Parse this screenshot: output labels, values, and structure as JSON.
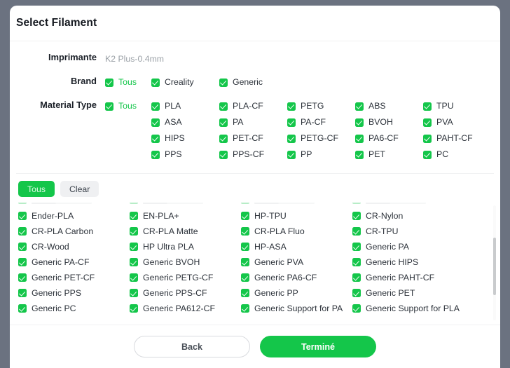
{
  "dialog": {
    "title": "Select Filament"
  },
  "filters": {
    "printer": {
      "label": "Imprimante",
      "value": "K2 Plus-0.4mm"
    },
    "brand": {
      "label": "Brand",
      "options": [
        {
          "label": "Tous",
          "checked": true,
          "accent": true
        },
        {
          "label": "Creality",
          "checked": true,
          "accent": false
        },
        {
          "label": "Generic",
          "checked": true,
          "accent": false
        }
      ]
    },
    "material_type": {
      "label": "Material Type",
      "all_label": "Tous",
      "all_checked": true,
      "rows": [
        [
          "PLA",
          "PLA-CF",
          "PETG",
          "ABS",
          "TPU"
        ],
        [
          "ASA",
          "PA",
          "PA-CF",
          "BVOH",
          "PVA"
        ],
        [
          "HIPS",
          "PET-CF",
          "PETG-CF",
          "PA6-CF",
          "PAHT-CF"
        ],
        [
          "PPS",
          "PPS-CF",
          "PP",
          "PET",
          "PC"
        ]
      ]
    }
  },
  "toolbar": {
    "all_label": "Tous",
    "clear_label": "Clear"
  },
  "filament_list": {
    "rows": [
      [
        "Ender-PLA",
        "EN-PLA+",
        "HP-TPU",
        "CR-Nylon"
      ],
      [
        "CR-PLA Carbon",
        "CR-PLA Matte",
        "CR-PLA Fluo",
        "CR-TPU"
      ],
      [
        "CR-Wood",
        "HP Ultra PLA",
        "HP-ASA",
        "Generic PA"
      ],
      [
        "Generic PA-CF",
        "Generic BVOH",
        "Generic PVA",
        "Generic HIPS"
      ],
      [
        "Generic PET-CF",
        "Generic PETG-CF",
        "Generic PA6-CF",
        "Generic PAHT-CF"
      ],
      [
        "Generic PPS",
        "Generic PPS-CF",
        "Generic PP",
        "Generic PET"
      ],
      [
        "Generic PC",
        "Generic PA612-CF",
        "Generic Support for PA",
        "Generic Support for PLA"
      ]
    ]
  },
  "footer": {
    "back_label": "Back",
    "done_label": "Terminé"
  },
  "colors": {
    "accent_green": "#14c64a",
    "backdrop": "#6b7280",
    "text_primary": "#1a1f27",
    "text_muted": "#9aa0a6"
  }
}
